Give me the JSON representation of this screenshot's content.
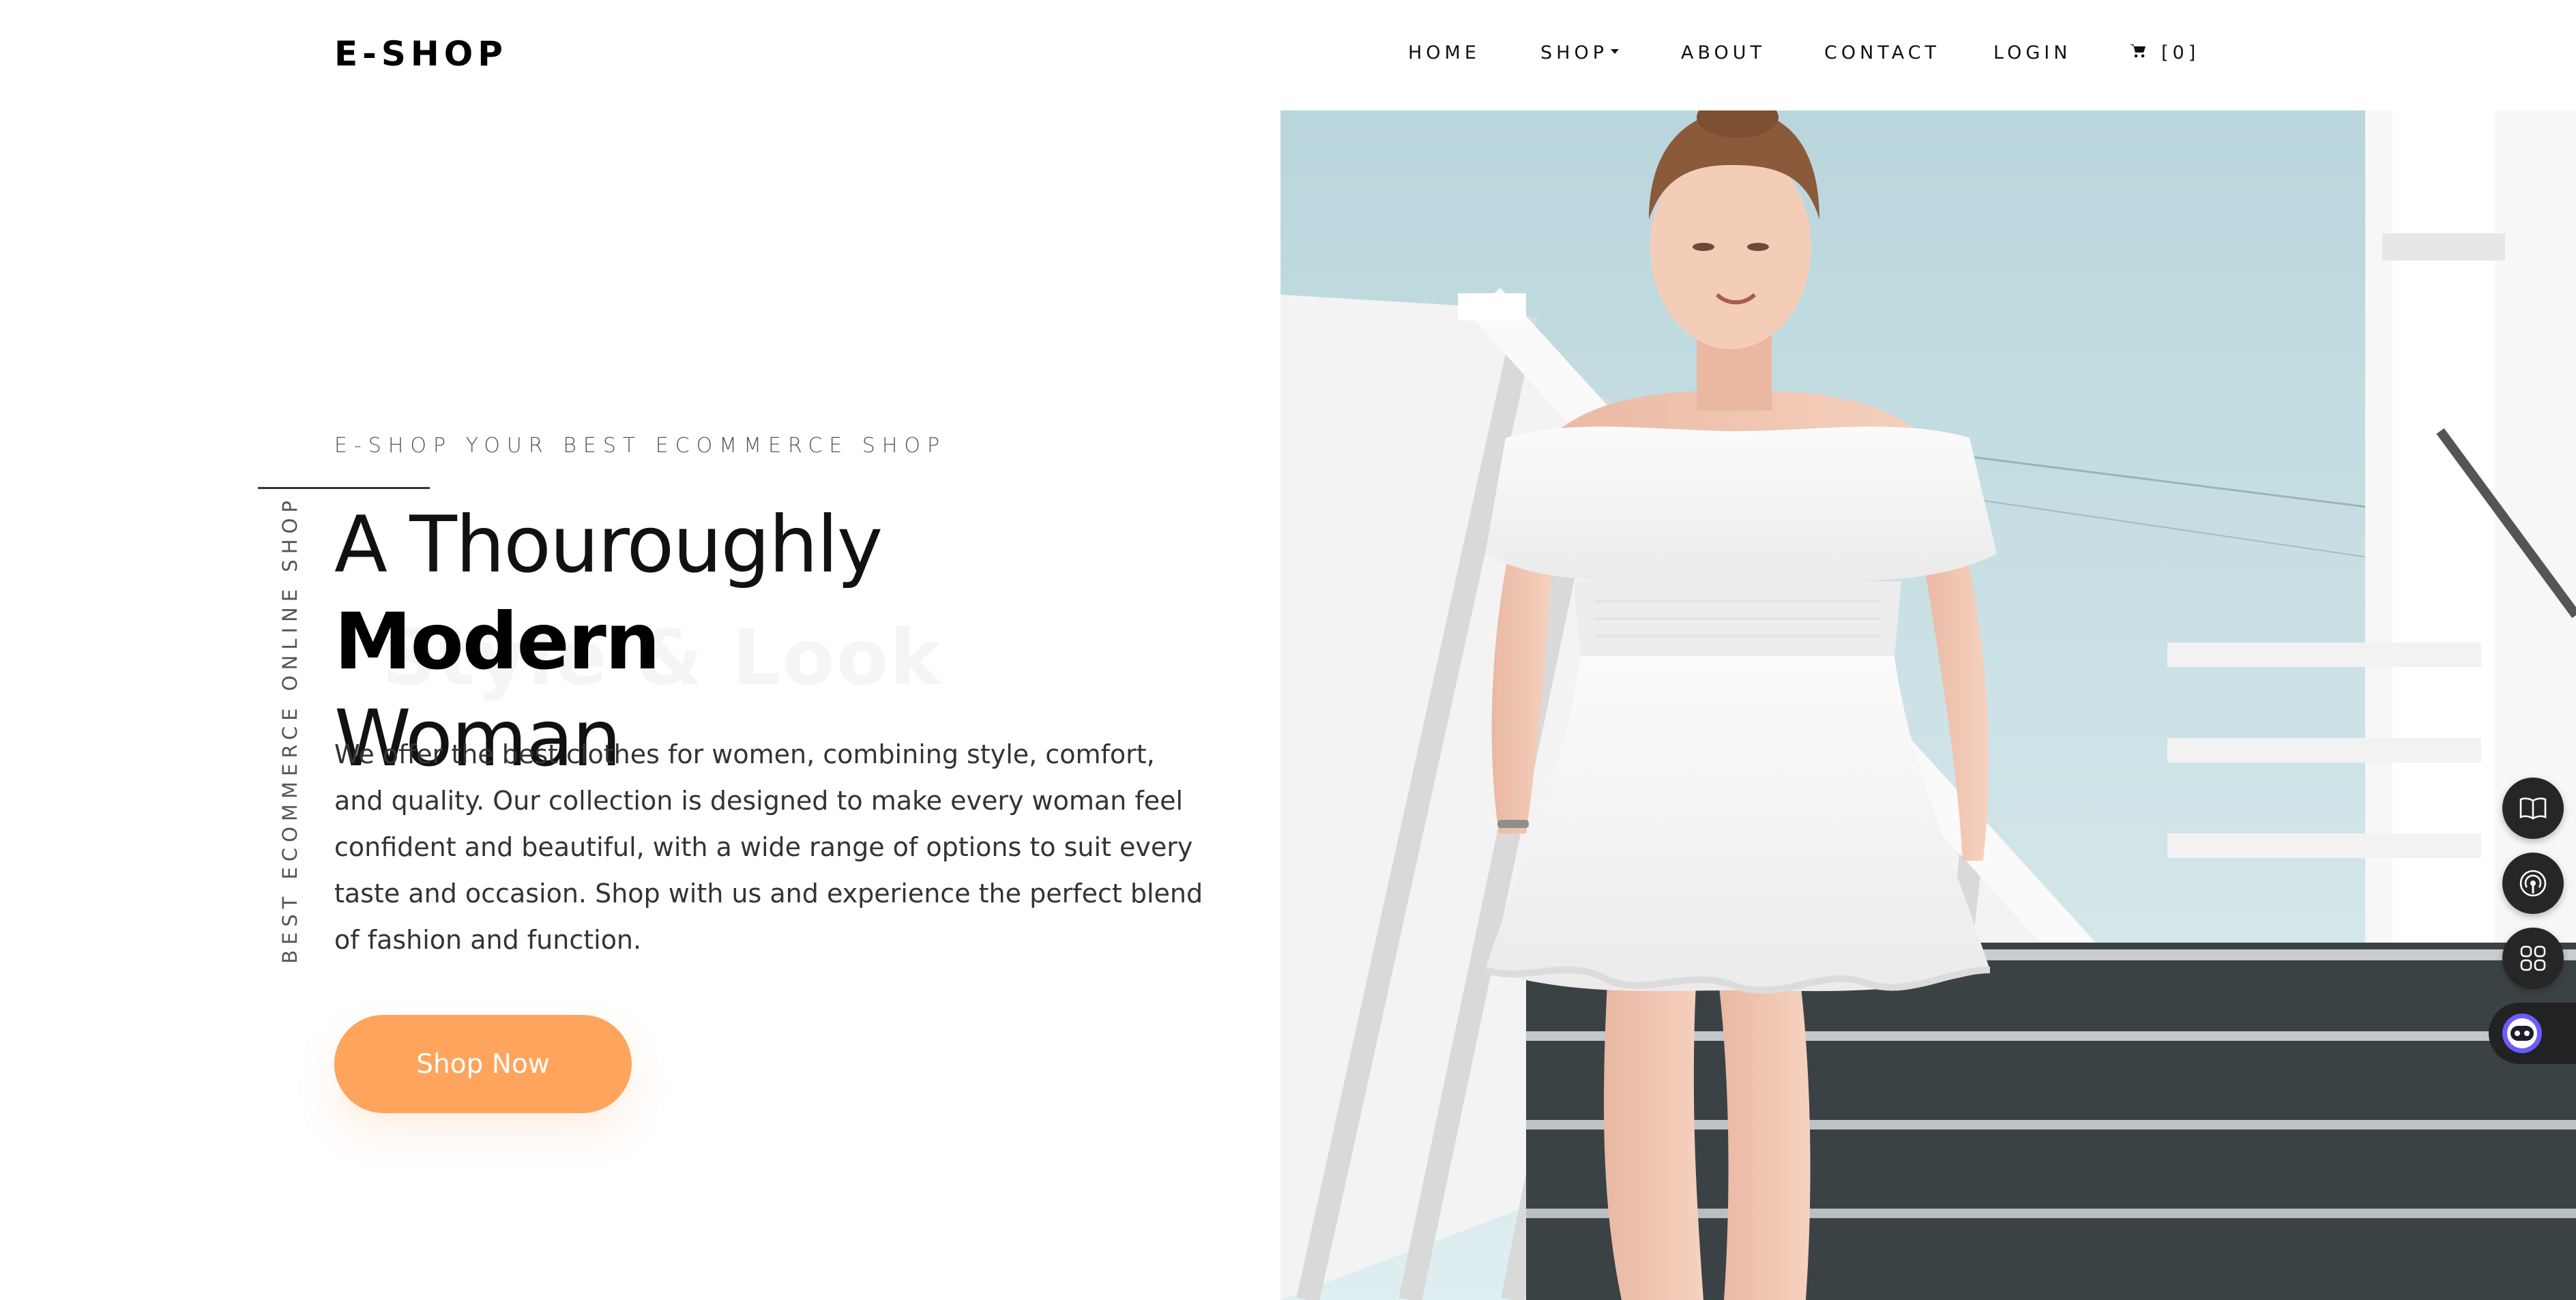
{
  "brand": {
    "logo": "E-SHOP"
  },
  "nav": {
    "items": [
      {
        "label": "HOME"
      },
      {
        "label": "SHOP"
      },
      {
        "label": "ABOUT"
      },
      {
        "label": "CONTACT"
      },
      {
        "label": "LOGIN"
      }
    ],
    "cart_count": "[0]"
  },
  "hero": {
    "kicker": "E-SHOP YOUR BEST ECOMMERCE SHOP",
    "vertical_text": "BEST ECOMMERCE ONLINE SHOP",
    "headline_part1": "A Thouroughly ",
    "headline_bold": "Modern",
    "headline_part2": "Woman",
    "ghost_text": "Style & Look",
    "description": "We offer the best clothes for women, combining style, comfort, and quality. Our collection is designed to make every woman feel confident and beautiful, with a wide range of options to suit every taste and occasion. Shop with us and experience the perfect blend of fashion and function.",
    "cta_label": "Shop Now"
  },
  "colors": {
    "accent": "#ffa45c",
    "text": "#111111",
    "muted": "#555555",
    "tool_bg": "#262626"
  },
  "icons": [
    "cart-icon",
    "caret-down-icon",
    "book-icon",
    "broadcast-icon",
    "grid-icon",
    "assistant-icon"
  ]
}
